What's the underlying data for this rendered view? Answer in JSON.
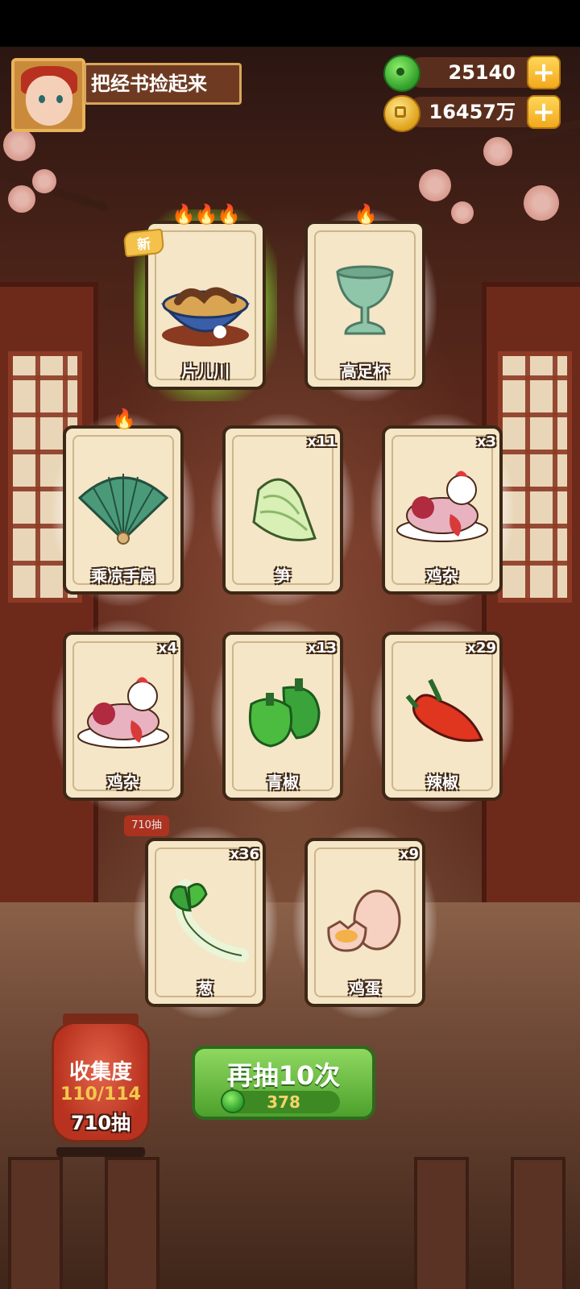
{
  "player": {
    "task": "把经书捡起来"
  },
  "currencies": [
    {
      "name": "jade",
      "value": "25140"
    },
    {
      "name": "coin",
      "value": "16457万"
    }
  ],
  "cards": [
    {
      "name": "片儿川",
      "count": "",
      "flames": "🔥🔥🔥",
      "is_new": true,
      "new_label": "新"
    },
    {
      "name": "高足杯",
      "count": "",
      "flames": "🔥",
      "is_new": false
    },
    {
      "name": "乘凉手扇",
      "count": "",
      "flames": "🔥",
      "is_new": false
    },
    {
      "name": "笋",
      "count": "x11",
      "flames": "",
      "is_new": false
    },
    {
      "name": "鸡杂",
      "count": "x3",
      "flames": "",
      "is_new": false
    },
    {
      "name": "鸡杂",
      "count": "x4",
      "flames": "",
      "is_new": false
    },
    {
      "name": "青椒",
      "count": "x13",
      "flames": "",
      "is_new": false
    },
    {
      "name": "辣椒",
      "count": "x29",
      "flames": "",
      "is_new": false
    },
    {
      "name": "葱",
      "count": "x36",
      "flames": "",
      "is_new": false
    },
    {
      "name": "鸡蛋",
      "count": "x9",
      "flames": "",
      "is_new": false
    }
  ],
  "collection": {
    "label": "收集度",
    "progress": "110/114",
    "draws": "710抽"
  },
  "redraw": {
    "label": "再抽10次",
    "cost": "378"
  },
  "behind_label": "710抽",
  "colors": {
    "button_green": "#4ca12c",
    "card_bg": "#f4e6c6",
    "glow_green": "#a0ff46"
  }
}
